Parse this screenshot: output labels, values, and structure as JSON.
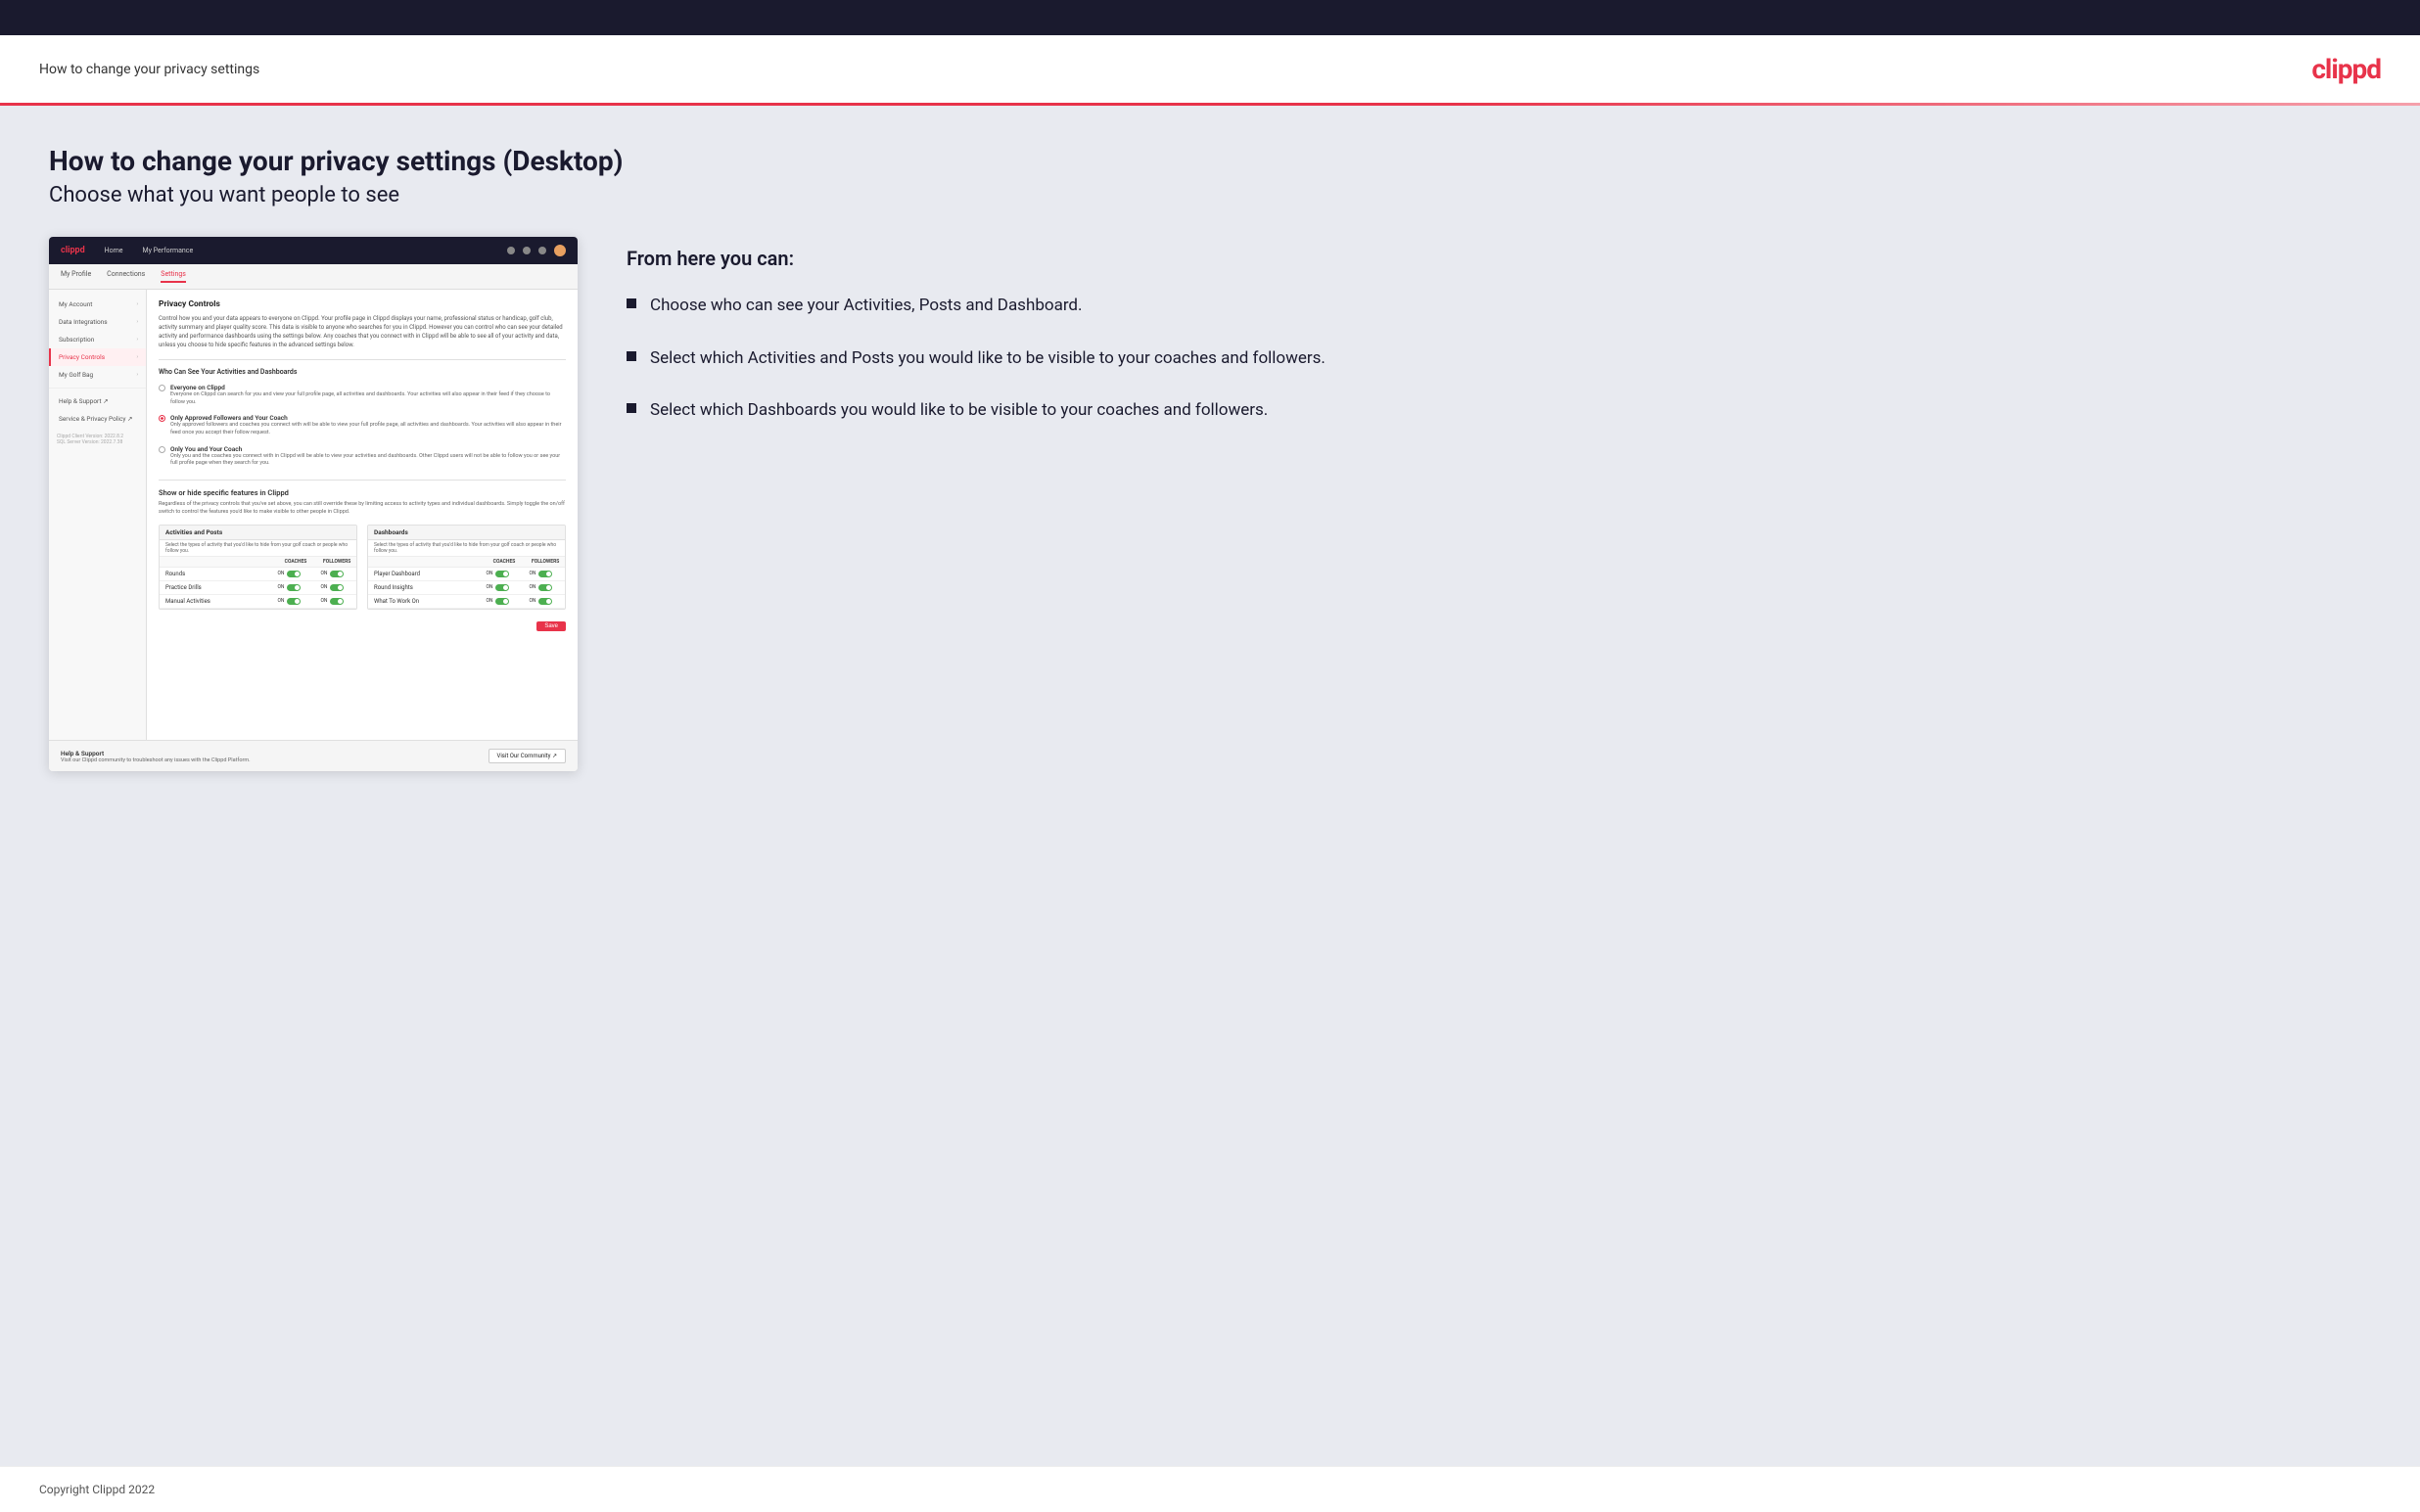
{
  "header": {
    "title": "How to change your privacy settings",
    "logo": "clippd"
  },
  "main": {
    "heading": "How to change your privacy settings (Desktop)",
    "subheading": "Choose what you want people to see",
    "from_here": "From here you can:",
    "bullets": [
      "Choose who can see your Activities, Posts and Dashboard.",
      "Select which Activities and Posts you would like to be visible to your coaches and followers.",
      "Select which Dashboards you would like to be visible to your coaches and followers."
    ]
  },
  "mock_app": {
    "nav": {
      "logo": "clippd",
      "items": [
        "Home",
        "My Performance"
      ]
    },
    "subnav": {
      "items": [
        "My Profile",
        "Connections",
        "Settings"
      ]
    },
    "sidebar": {
      "items": [
        {
          "label": "My Account",
          "active": false
        },
        {
          "label": "Data Integrations",
          "active": false
        },
        {
          "label": "Subscription",
          "active": false
        },
        {
          "label": "Privacy Controls",
          "active": true
        },
        {
          "label": "My Golf Bag",
          "active": false
        },
        {
          "label": "Help & Support",
          "active": false
        },
        {
          "label": "Service & Privacy Policy",
          "active": false
        }
      ],
      "version": "Clippd Client Version: 2022.8.2\nSQL Server Version: 2022.7.38"
    },
    "privacy_controls": {
      "section_title": "Privacy Controls",
      "section_desc": "Control how you and your data appears to everyone on Clippd. Your profile page in Clippd displays your name, professional status or handicap, golf club, activity summary and player quality score. This data is visible to anyone who searches for you in Clippd. However you can control who can see your detailed activity and performance dashboards using the settings below. Any coaches that you connect with in Clippd will be able to see all of your activity and data, unless you choose to hide specific features in the advanced settings below.",
      "who_title": "Who Can See Your Activities and Dashboards",
      "radio_options": [
        {
          "label": "Everyone on Clippd",
          "desc": "Everyone on Clippd can search for you and view your full profile page, all activities and dashboards. Your activities will also appear in their feed if they choose to follow you.",
          "selected": false
        },
        {
          "label": "Only Approved Followers and Your Coach",
          "desc": "Only approved followers and coaches you connect with will be able to view your full profile page, all activities and dashboards. Your activities will also appear in their feed once you accept their follow request.",
          "selected": true
        },
        {
          "label": "Only You and Your Coach",
          "desc": "Only you and the coaches you connect with in Clippd will be able to view your activities and dashboards. Other Clippd users will not be able to follow you or see your full profile page when they search for you.",
          "selected": false
        }
      ],
      "showhide_title": "Show or hide specific features in Clippd",
      "showhide_desc": "Regardless of the privacy controls that you've set above, you can still override these by limiting access to activity types and individual dashboards. Simply toggle the on/off switch to control the features you'd like to make visible to other people in Clippd.",
      "activities_posts": {
        "title": "Activities and Posts",
        "desc": "Select the types of activity that you'd like to hide from your golf coach or people who follow you.",
        "rows": [
          {
            "label": "Rounds"
          },
          {
            "label": "Practice Drills"
          },
          {
            "label": "Manual Activities"
          }
        ]
      },
      "dashboards": {
        "title": "Dashboards",
        "desc": "Select the types of activity that you'd like to hide from your golf coach or people who follow you.",
        "rows": [
          {
            "label": "Player Dashboard"
          },
          {
            "label": "Round Insights"
          },
          {
            "label": "What To Work On"
          }
        ]
      },
      "save_label": "Save"
    },
    "help": {
      "title": "Help & Support",
      "desc": "Visit our Clippd community to troubleshoot any issues with the Clippd Platform.",
      "button_label": "Visit Our Community"
    }
  },
  "footer": {
    "copyright": "Copyright Clippd 2022"
  }
}
